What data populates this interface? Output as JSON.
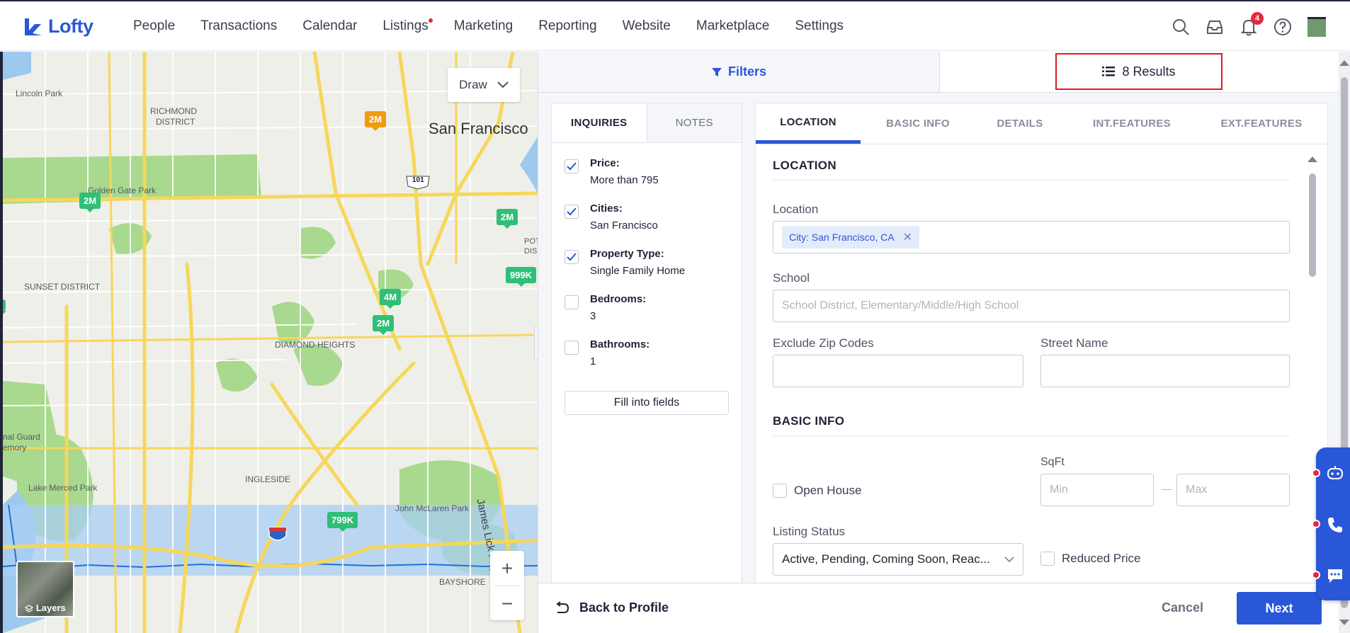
{
  "nav": {
    "brand": "Lofty",
    "items": [
      {
        "label": "People",
        "dot": false
      },
      {
        "label": "Transactions",
        "dot": false
      },
      {
        "label": "Calendar",
        "dot": false
      },
      {
        "label": "Listings",
        "dot": true
      },
      {
        "label": "Marketing",
        "dot": false
      },
      {
        "label": "Reporting",
        "dot": false
      },
      {
        "label": "Website",
        "dot": false
      },
      {
        "label": "Marketplace",
        "dot": false
      },
      {
        "label": "Settings",
        "dot": false
      }
    ],
    "notification_count": "4",
    "icons": [
      "search-icon",
      "inbox-icon",
      "bell-icon",
      "help-icon",
      "avatar"
    ]
  },
  "map": {
    "draw_label": "Draw",
    "layers_label": "Layers",
    "zoom_in": "+",
    "zoom_out": "−",
    "labels": {
      "lincoln_park": "Lincoln Park",
      "richmond": "RICHMOND",
      "district": "DISTRICT",
      "golden_gate": "Golden Gate Park",
      "san_francisco": "San Francisco",
      "sunset": "SUNSET DISTRICT",
      "diamond": "DIAMOND HEIGHTS",
      "ingleside": "INGLESIDE",
      "lake_merced": "Lake Merced Park",
      "mclaren": "John McLaren Park",
      "bayshore": "BAYSHORE",
      "james_lick": "James Lick Fwy",
      "nal_guard": "nal Guard",
      "emory": "emory",
      "pot": "POT",
      "dis": "DIS",
      "hwy101": "101"
    },
    "pins": [
      {
        "label": "2M",
        "color": "orange"
      },
      {
        "label": "2M",
        "color": "green"
      },
      {
        "label": "2M",
        "color": "green"
      },
      {
        "label": "999K",
        "color": "green"
      },
      {
        "label": "4M",
        "color": "green"
      },
      {
        "label": "2M",
        "color": "green"
      },
      {
        "label": "799K",
        "color": "green"
      }
    ]
  },
  "panel": {
    "filters_label": "Filters",
    "results_label": "8 Results",
    "inquiry_tabs": [
      "INQUIRIES",
      "NOTES"
    ],
    "inquiries": [
      {
        "title": "Price:",
        "value": "More than 795",
        "checked": true
      },
      {
        "title": "Cities:",
        "value": "San Francisco",
        "checked": true
      },
      {
        "title": "Property Type:",
        "value": "Single Family Home",
        "checked": true
      },
      {
        "title": "Bedrooms:",
        "value": "3",
        "checked": false
      },
      {
        "title": "Bathrooms:",
        "value": "1",
        "checked": false
      }
    ],
    "fill_button": "Fill into fields",
    "form_tabs": [
      "LOCATION",
      "BASIC INFO",
      "DETAILS",
      "INT.FEATURES",
      "EXT.FEATURES"
    ],
    "location": {
      "section": "LOCATION",
      "location_label": "Location",
      "location_chip": "City: San Francisco, CA",
      "school_label": "School",
      "school_placeholder": "School District, Elementary/Middle/High School",
      "exclude_zip_label": "Exclude Zip Codes",
      "street_label": "Street Name"
    },
    "basic": {
      "section": "BASIC INFO",
      "sqft_label": "SqFt",
      "sqft_min": "Min",
      "sqft_max": "Max",
      "sqft_sep": "—",
      "open_house": "Open House",
      "listing_status_label": "Listing Status",
      "listing_status_value": "Active, Pending, Coming Soon, Reac...",
      "reduced_price": "Reduced Price"
    },
    "footer": {
      "back": "Back to Profile",
      "cancel": "Cancel",
      "next": "Next"
    }
  },
  "colors": {
    "brand": "#2a57d8",
    "pin_green": "#2fbf77",
    "pin_orange": "#f19c10",
    "alert_red": "#e8283e",
    "highlight_box": "#e01b24"
  }
}
